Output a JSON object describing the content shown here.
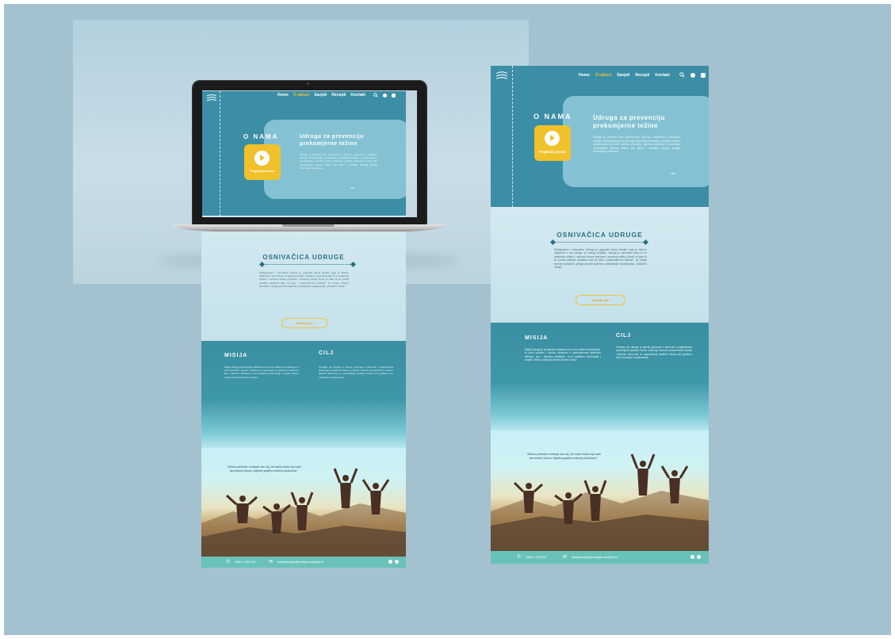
{
  "site": {
    "nav": {
      "items": [
        "Home",
        "O udruzi",
        "Savjeti",
        "Recepti",
        "Kontakt"
      ],
      "active_index": 1
    },
    "hero": {
      "heading": "O NAMA",
      "video_label": "Pogledaj promo",
      "card_title_line1": "Udruga za prevenciju",
      "card_title_line2": "prekomjerne težine",
      "card_text": "Udruga je osnovan kao dobrotvorna, stručna, neprofitna i nevladina udruga. Udruga djeluje na području Republike Hrvatske, a svojim radom i angažmanom promiče zdravu prehranu, tjelesnu aktivnost i prevenciju prekomjerne tjelesne težine kod djece i odraslih. Udruga okuplja stručnjake i volontere.",
      "more_link": "više →"
    },
    "founder": {
      "title": "OSNIVAČICA UDRUGE",
      "text": "Predsjednica i osnivačica Udruge je gospođa Vesna Nuskić, koja je aktivno uključena u rad udruge od samog početka. Udruga je osnovana kako bi se potaknula svijest o važnosti zdrave prehrane i pravilnog načina života, te kako bi se pružila podrška osobama koje se bore s prekomjernom težinom. Uz brojne stručne suradnike, udruga provodi radionice, predavanja i savjetovanja. „Zamjeni i uživaj!\"",
      "button": "Saznaj više"
    },
    "mission": {
      "title": "MISIJA",
      "text": "Misija Udruge je da djeluje edukativno kroz sve oblike komunikacije, te pruži podršku i pomoć osobama s prekomjernom tjelesnom težinom, kao i njihovim obiteljima. Kroz kvalitetne informacije i savjete želimo potaknuti zdrave životne navike."
    },
    "goal": {
      "title": "CILJ",
      "text": "Temeljni cilj Udruge je širenje spoznaje o štetnosti i posljedicama prekomjerne tjelesne težine, poticanje zdravih prehrambenih navika i tjelesne aktivnosti, te unapređenje kvalitete života svih građana kroz edukaciju i savjetovanje."
    },
    "quote": "\"Zdrava prehrana i kretanje nisu cilj, već način života koji svaki dan biramo iznova. Zajedno gradimo zdraviju budućnost.\"",
    "footer": {
      "phone": "+385 1 234 567",
      "email": "savjetovanje@udruga-zamjeni.hr"
    },
    "icons": [
      "logo-icon",
      "search-icon",
      "play-icon",
      "phone-icon",
      "mail-icon",
      "facebook-icon",
      "instagram-icon"
    ]
  },
  "colors": {
    "background": "#a3c1cf",
    "teal": "#3b8ea5",
    "accent_yellow": "#f1c12b",
    "footer_green": "#69c2b8"
  }
}
